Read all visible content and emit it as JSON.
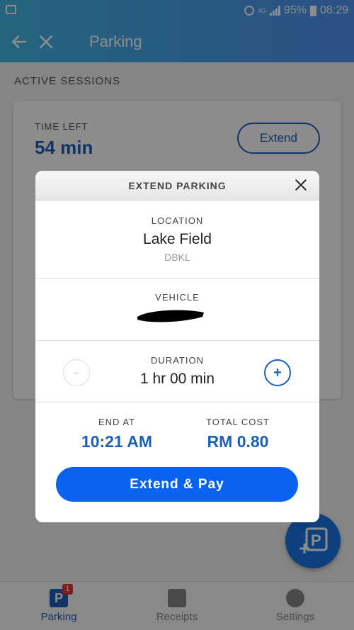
{
  "status_bar": {
    "battery": "95%",
    "time": "08:29",
    "network": "4G"
  },
  "app_bar": {
    "title": "Parking"
  },
  "active_sessions": {
    "label": "ACTIVE SESSIONS",
    "time_left_label": "TIME LEFT",
    "time_left_value": "54 min",
    "extend_label": "Extend"
  },
  "modal": {
    "title": "EXTEND PARKING",
    "location_label": "LOCATION",
    "location_name": "Lake Field",
    "location_authority": "DBKL",
    "vehicle_label": "VEHICLE",
    "duration_label": "DURATION",
    "duration_value": "1 hr 00 min",
    "minus_label": "-",
    "plus_label": "+",
    "end_at_label": "END AT",
    "end_at_value": "10:21 AM",
    "total_cost_label": "TOTAL COST",
    "total_cost_value": "RM 0.80",
    "pay_label": "Extend & Pay"
  },
  "bottom_nav": {
    "items": [
      {
        "label": "Parking",
        "badge": "1"
      },
      {
        "label": "Receipts"
      },
      {
        "label": "Settings"
      }
    ]
  },
  "colors": {
    "accent": "#1d5fb8",
    "primary_button": "#0a63f0",
    "badge": "#d83a3a"
  }
}
